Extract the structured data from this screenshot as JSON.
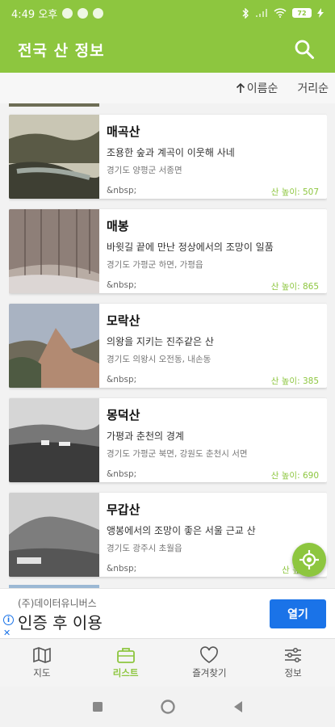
{
  "status_bar": {
    "time": "4:49 오후",
    "battery": "72"
  },
  "app_bar": {
    "title": "전국 산 정보"
  },
  "sort": {
    "by_name": "이름순",
    "by_distance": "거리순"
  },
  "mountains": [
    {
      "name": "매곡산",
      "desc": "조용한 숲과 계곡이 이웃해 사네",
      "addr": "경기도 양평군 서종면",
      "note": "&nbsp;",
      "height": "산 높이: 507"
    },
    {
      "name": "매봉",
      "desc": "바윗길 끝에 만난 정상에서의 조망이 일품",
      "addr": "경기도 가평군 하면, 가평읍",
      "note": "&nbsp;",
      "height": "산 높이: 865"
    },
    {
      "name": "모락산",
      "desc": "의왕을 지키는 진주같은 산",
      "addr": "경기도 의왕시 오전동, 내손동",
      "note": "&nbsp;",
      "height": "산 높이: 385"
    },
    {
      "name": "몽덕산",
      "desc": "가평과 춘천의 경계",
      "addr": "경기도 가평군 북면, 강원도 춘천시 서면",
      "note": "&nbsp;",
      "height": "산 높이: 690"
    },
    {
      "name": "무갑산",
      "desc": "앵봉에서의 조망이 좋은 서울 근교 산",
      "addr": "경기도 광주시 초월읍",
      "note": "&nbsp;",
      "height": "산 높이: 5"
    }
  ],
  "ad": {
    "advertiser": "(주)데이터유니버스",
    "headline": "인증 후 이용",
    "open_label": "열기"
  },
  "bottom_nav": [
    {
      "label": "지도",
      "icon": "map-icon"
    },
    {
      "label": "리스트",
      "icon": "briefcase-icon"
    },
    {
      "label": "즐겨찾기",
      "icon": "heart-icon"
    },
    {
      "label": "정보",
      "icon": "sliders-icon"
    }
  ],
  "colors": {
    "primary": "#8dc63f",
    "ad_button": "#1a73e8"
  }
}
